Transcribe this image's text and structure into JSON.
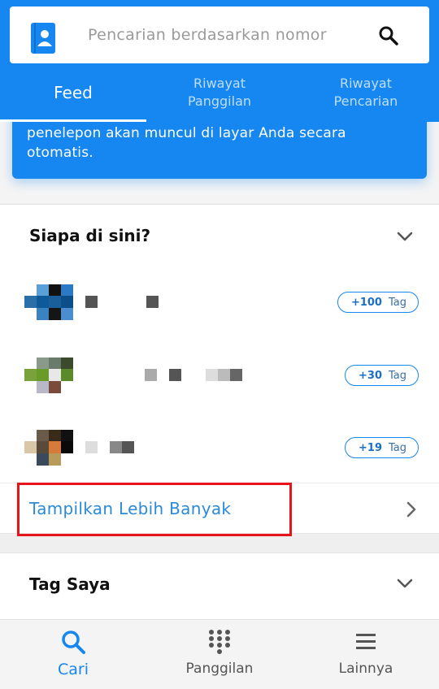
{
  "search": {
    "placeholder": "Pencarian berdasarkan nomor"
  },
  "tabs": [
    {
      "label": "Feed",
      "active": true
    },
    {
      "label": "Riwayat\nPanggilan",
      "active": false
    },
    {
      "label": "Riwayat\nPencarian",
      "active": false
    }
  ],
  "info_card": {
    "text": "penelepon akan muncul di layar Anda secara otomatis."
  },
  "who_section": {
    "title": "Siapa di sini?",
    "people": [
      {
        "tag_count": "+100",
        "tag_word": "Tag"
      },
      {
        "tag_count": "+30",
        "tag_word": "Tag"
      },
      {
        "tag_count": "+19",
        "tag_word": "Tag"
      }
    ],
    "show_more_label": "Tampilkan Lebih Banyak"
  },
  "tags_section": {
    "title": "Tag Saya"
  },
  "bottom_nav": [
    {
      "label": "Cari",
      "icon": "search-icon",
      "active": true
    },
    {
      "label": "Panggilan",
      "icon": "dialpad-icon",
      "active": false
    },
    {
      "label": "Lainnya",
      "icon": "menu-icon",
      "active": false
    }
  ],
  "colors": {
    "primary": "#1686f0",
    "highlight": "#e8141c",
    "link": "#2b8ad8"
  }
}
